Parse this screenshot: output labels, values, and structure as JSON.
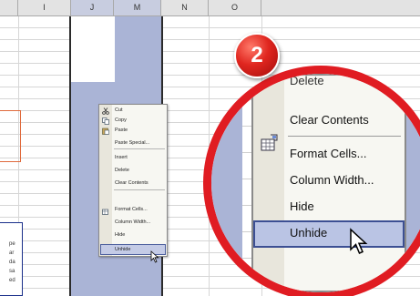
{
  "columns": [
    "I",
    "J",
    "M",
    "N",
    "O"
  ],
  "context_menu": {
    "items": [
      "Cut",
      "Copy",
      "Paste",
      "Paste Special...",
      "Insert",
      "Delete",
      "Clear Contents",
      "Format Cells...",
      "Column Width...",
      "Hide",
      "Unhide"
    ],
    "highlighted": "Unhide"
  },
  "zoom_menu": {
    "partial_top": "Delete",
    "items": [
      "Clear Contents",
      "Format Cells...",
      "Column Width...",
      "Hide",
      "Unhide"
    ],
    "highlighted": "Unhide"
  },
  "side_text": [
    "pe",
    "ar",
    "da",
    "sa",
    "ed"
  ],
  "step_badge": "2",
  "colors": {
    "selection": "#aab4d6",
    "zoom_ring": "#e01c22",
    "highlight_border": "#3c4f93"
  }
}
